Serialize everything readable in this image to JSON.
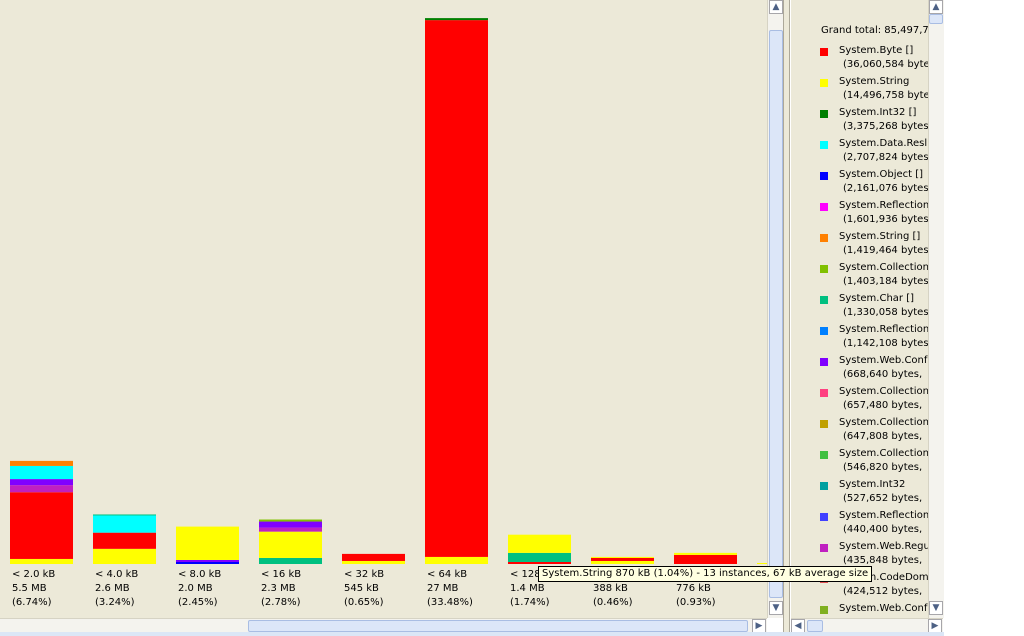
{
  "chart_data": {
    "type": "bar",
    "stacked": true,
    "categories": [
      "< 2.0 kB",
      "< 4.0 kB",
      "< 8.0 kB",
      "< 16 kB",
      "< 32 kB",
      "< 64 kB",
      "< 128",
      "",
      "",
      ""
    ],
    "size_labels": [
      "5.5 MB",
      "2.6 MB",
      "2.0 MB",
      "2.3 MB",
      "545 kB",
      "27 MB",
      "1.4 MB",
      "388 kB",
      "776 kB",
      ""
    ],
    "percent_labels": [
      "(6.74%)",
      "(3.24%)",
      "(2.45%)",
      "(2.78%)",
      "(0.65%)",
      "(33.48%)",
      "(1.74%)",
      "(0.46%)",
      "(0.93%)",
      ""
    ],
    "ylim": [
      0,
      27.5
    ],
    "unit": "MB",
    "segments": [
      [
        {
          "type": "System.String",
          "value": 0.25
        },
        {
          "type": "System.Byte []",
          "value": 3.3
        },
        {
          "type": "System.Web.Regu",
          "value": 0.35
        },
        {
          "type": "System.Web.Conf",
          "value": 0.3
        },
        {
          "type": "System.Data.Resl",
          "value": 0.65
        },
        {
          "type": "System.String []",
          "value": 0.25
        }
      ],
      [
        {
          "type": "System.String",
          "value": 0.75
        },
        {
          "type": "System.Byte []",
          "value": 0.8
        },
        {
          "type": "System.Data.Resl",
          "value": 0.85
        },
        {
          "type": "System.Char []",
          "value": 0.05
        }
      ],
      [
        {
          "type": "System.Object []",
          "value": 0.1
        },
        {
          "type": "System.Web.Conf",
          "value": 0.1
        },
        {
          "type": "System.String",
          "value": 1.65
        }
      ],
      [
        {
          "type": "System.Char []",
          "value": 0.3
        },
        {
          "type": "System.String",
          "value": 1.3
        },
        {
          "type": "System.Web.Regu",
          "value": 0.2
        },
        {
          "type": "System.Web.Conf",
          "value": 0.3
        },
        {
          "type": "System.Collection",
          "value": 0.1
        }
      ],
      [
        {
          "type": "System.String",
          "value": 0.15
        },
        {
          "type": "System.Byte []",
          "value": 0.35
        }
      ],
      [
        {
          "type": "System.String",
          "value": 0.35
        },
        {
          "type": "System.Byte []",
          "value": 26.55
        },
        {
          "type": "System.Int32 []",
          "value": 0.1
        }
      ],
      [
        {
          "type": "System.Byte []",
          "value": 0.1
        },
        {
          "type": "System.Char []",
          "value": 0.45
        },
        {
          "type": "System.String",
          "value": 0.9
        }
      ],
      [
        {
          "type": "System.String",
          "value": 0.15
        },
        {
          "type": "System.Byte []",
          "value": 0.15
        },
        {
          "type": "System.String",
          "value": 0.05
        }
      ],
      [
        {
          "type": "System.Byte []",
          "value": 0.45
        },
        {
          "type": "System.String",
          "value": 0.1
        }
      ],
      [
        {
          "type": "System.String",
          "value": 0.03
        }
      ]
    ],
    "grand_total_label": "Grand total: 85,497,7",
    "legend": [
      {
        "name": "System.Byte []",
        "bytes": "(36,060,584 byte",
        "color": "#ff0000"
      },
      {
        "name": "System.String",
        "bytes": "(14,496,758 byte",
        "color": "#ffff00"
      },
      {
        "name": "System.Int32 []",
        "bytes": "(3,375,268 bytes",
        "color": "#008000"
      },
      {
        "name": "System.Data.Resl",
        "bytes": "(2,707,824 bytes",
        "color": "#00ffff"
      },
      {
        "name": "System.Object []",
        "bytes": "(2,161,076 bytes",
        "color": "#0000ff"
      },
      {
        "name": "System.Reflection",
        "bytes": "(1,601,936 bytes",
        "color": "#ff00ff"
      },
      {
        "name": "System.String []",
        "bytes": "(1,419,464 bytes",
        "color": "#ff8000"
      },
      {
        "name": "System.Collection",
        "bytes": "(1,403,184 bytes",
        "color": "#80c000"
      },
      {
        "name": "System.Char []",
        "bytes": "(1,330,058 bytes",
        "color": "#00c080"
      },
      {
        "name": "System.Reflection",
        "bytes": "(1,142,108 bytes",
        "color": "#0080ff"
      },
      {
        "name": "System.Web.Conf",
        "bytes": "(668,640 bytes,",
        "color": "#8000ff"
      },
      {
        "name": "System.Collection",
        "bytes": "(657,480 bytes,",
        "color": "#ff4080"
      },
      {
        "name": "System.Collection",
        "bytes": "(647,808 bytes,",
        "color": "#c0a000"
      },
      {
        "name": "System.Collection",
        "bytes": "(546,820 bytes,",
        "color": "#40c040"
      },
      {
        "name": "System.Int32",
        "bytes": "(527,652 bytes,",
        "color": "#00a0a0"
      },
      {
        "name": "System.Reflection",
        "bytes": "(440,400 bytes,",
        "color": "#4040ff"
      },
      {
        "name": "System.Web.Regu",
        "bytes": "(435,848 bytes,",
        "color": "#c020c0"
      },
      {
        "name": "System.CodeDom",
        "bytes": "(424,512 bytes,",
        "color": "#e05050"
      },
      {
        "name": "System.Web.Conf",
        "bytes": "",
        "color": "#80b020"
      }
    ]
  },
  "tooltip": {
    "text": "System.String 870 kB (1.04%) - 13 instances, 67 kB average size"
  },
  "scroll_glyphs": {
    "up": "▲",
    "down": "▼",
    "left": "◀",
    "right": "▶"
  }
}
